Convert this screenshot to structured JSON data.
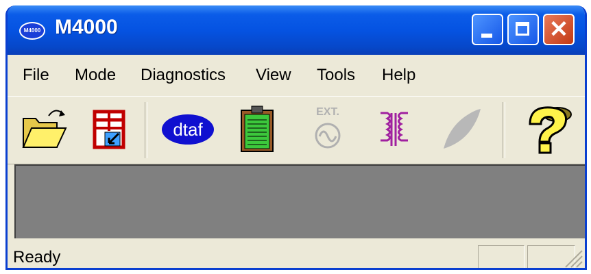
{
  "window": {
    "title": "M4000",
    "logo_text": "M4000"
  },
  "menu": [
    "File",
    "Mode",
    "Diagnostics",
    "View",
    "Tools",
    "Help"
  ],
  "toolbar": {
    "tools": [
      {
        "name": "open-folder-icon",
        "enabled": true
      },
      {
        "name": "save-table-icon",
        "enabled": true
      },
      {
        "name": "dtaf-icon",
        "label": "dtaf",
        "enabled": true
      },
      {
        "name": "clipboard-icon",
        "enabled": true
      },
      {
        "name": "ext-source-icon",
        "label": "EXT.",
        "enabled": false
      },
      {
        "name": "transformer-icon",
        "enabled": true
      },
      {
        "name": "leaf-icon",
        "enabled": false
      },
      {
        "name": "help-icon",
        "enabled": true
      }
    ]
  },
  "status": {
    "text": "Ready"
  },
  "colors": {
    "titlebar": "#0553e2",
    "client_area": "#808080",
    "chrome": "#ece9d8",
    "transformer": "#a020a0"
  }
}
